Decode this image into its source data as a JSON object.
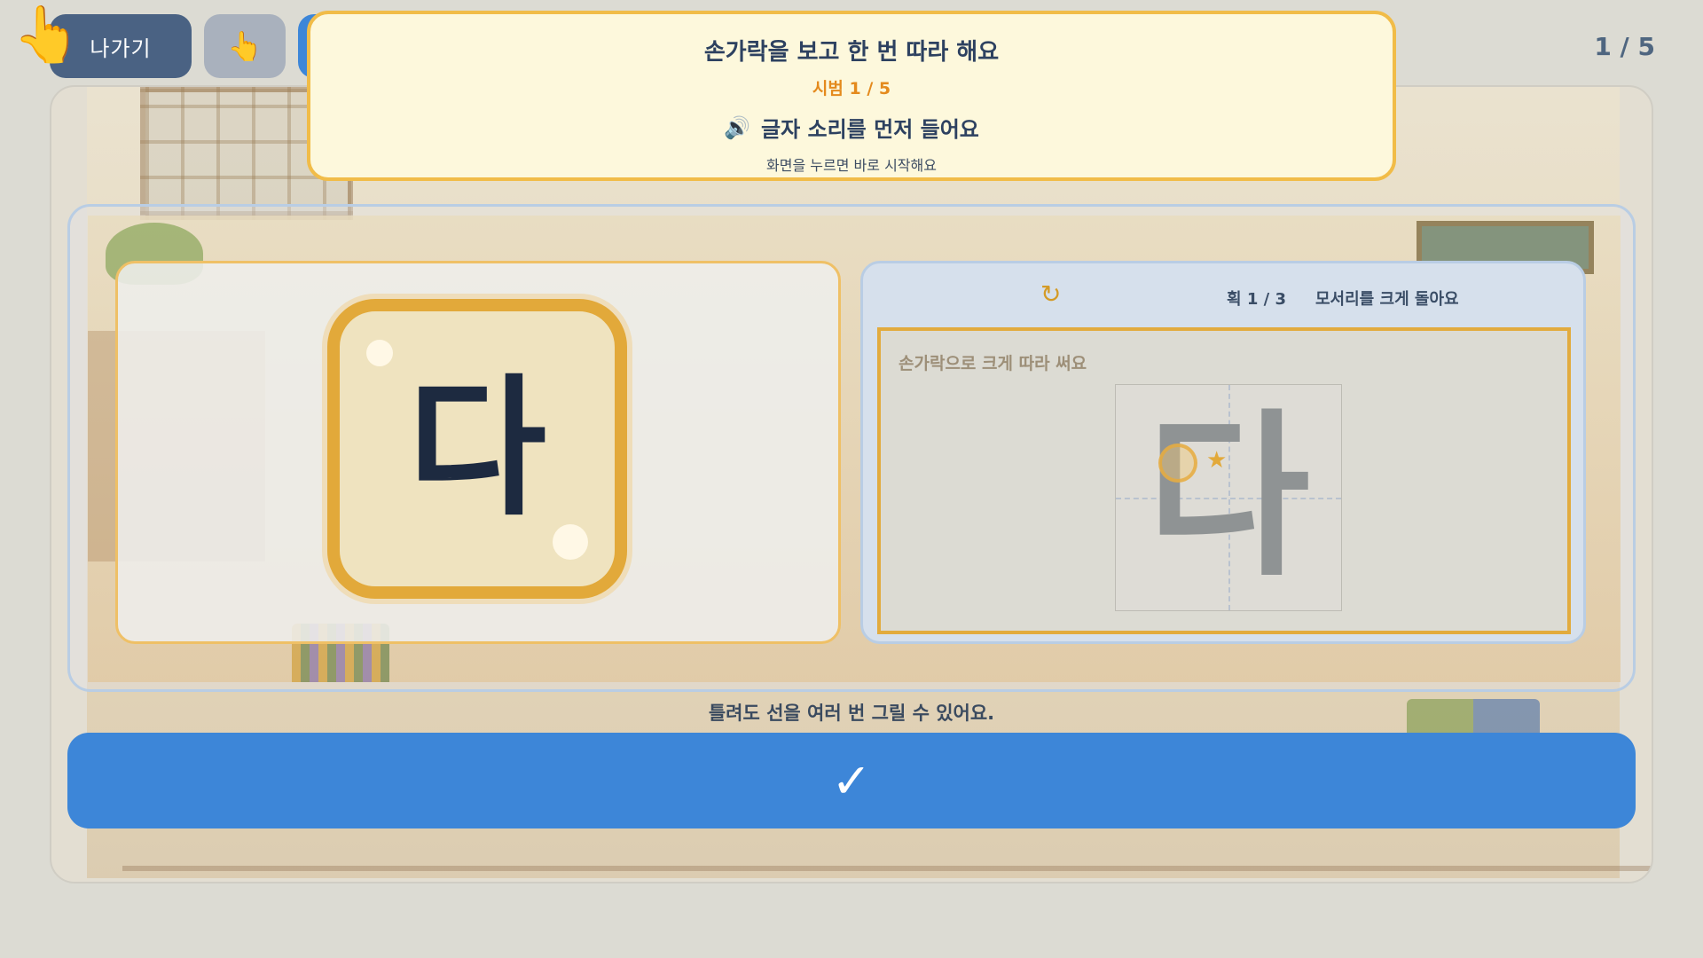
{
  "header": {
    "exit_label": "나가기",
    "hint_icon": "👆",
    "progress": "1 / 5"
  },
  "cursor_icon": "👆",
  "banner": {
    "title": "손가락을 보고 한 번 따라 해요",
    "step": "시범 1 / 5",
    "audio_icon": "🔊",
    "audio_label": "글자 소리를 먼저 들어요",
    "sub": "화면을 누르면 바로 시작해요"
  },
  "letter_card": {
    "letter": "다"
  },
  "trace_panel": {
    "redo_icon": "↻",
    "stroke_count": "획 1 / 3",
    "stroke_hint": "모서리를 크게 돌아요",
    "trace_label": "손가락으로 크게 따라 써요",
    "guide_letter": "다",
    "star_icon": "★"
  },
  "footer": {
    "hint": "틀려도 선을 여러 번 그릴 수 있어요.",
    "confirm_label": "✓"
  },
  "colors": {
    "primary_blue": "#3d86d8",
    "exit_button": "#4a6283",
    "accent_orange": "#e2a93a",
    "banner_bg": "#fdf8dc"
  }
}
